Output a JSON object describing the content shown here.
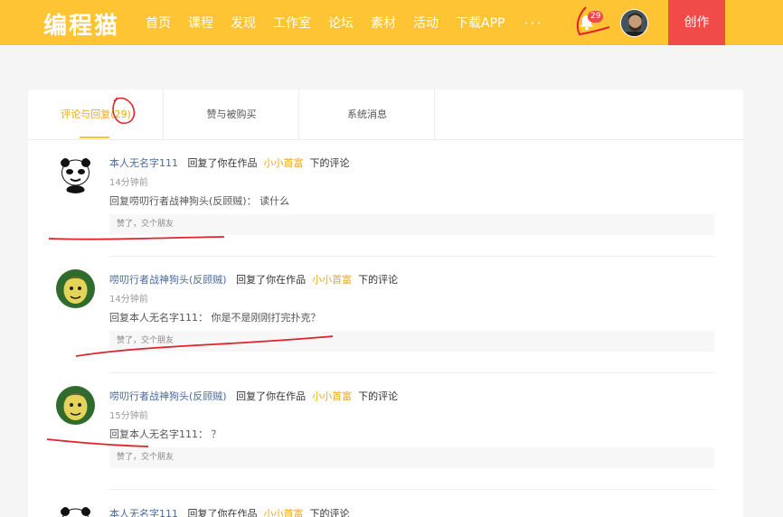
{
  "topbar": {
    "logo": "编程猫",
    "nav": [
      "首页",
      "课程",
      "发现",
      "工作室",
      "论坛",
      "素材",
      "活动",
      "下载APP"
    ],
    "more": "···",
    "badge_count": "29",
    "create_label": "创作",
    "colors": {
      "bar": "#fec433",
      "create": "#f04a49"
    }
  },
  "tabs": [
    {
      "label": "评论与回复(29)",
      "active": true
    },
    {
      "label": "赞与被购买",
      "active": false
    },
    {
      "label": "系统消息",
      "active": false
    }
  ],
  "notifications": [
    {
      "user": "本人无名字111",
      "action": "回复了你在作品",
      "work": "小小首富",
      "suffix": "下的评论",
      "time": "14分钟前",
      "reply": "回复唠叨行者战神狗头(反顾贼)：  读什么",
      "like": "赞了，交个朋友",
      "avatar": "panda-meme-icon"
    },
    {
      "user": "唠叨行者战神狗头(反顾贼)",
      "action": "回复了你在作品",
      "work": "小小首富",
      "suffix": "下的评论",
      "time": "14分钟前",
      "reply": "回复本人无名字111：  你是不是刚刚打完扑克？",
      "like": "赞了，交个朋友",
      "avatar": "cartoon-face-icon"
    },
    {
      "user": "唠叨行者战神狗头(反顾贼)",
      "action": "回复了你在作品",
      "work": "小小首富",
      "suffix": "下的评论",
      "time": "15分钟前",
      "reply": "回复本人无名字111：  ？",
      "like": "赞了，交个朋友",
      "avatar": "cartoon-face-icon"
    },
    {
      "user": "本人无名字111",
      "action": "回复了你在作品",
      "work": "小小首富",
      "suffix": "下的评论",
      "avatar": "panda-meme-icon"
    }
  ]
}
